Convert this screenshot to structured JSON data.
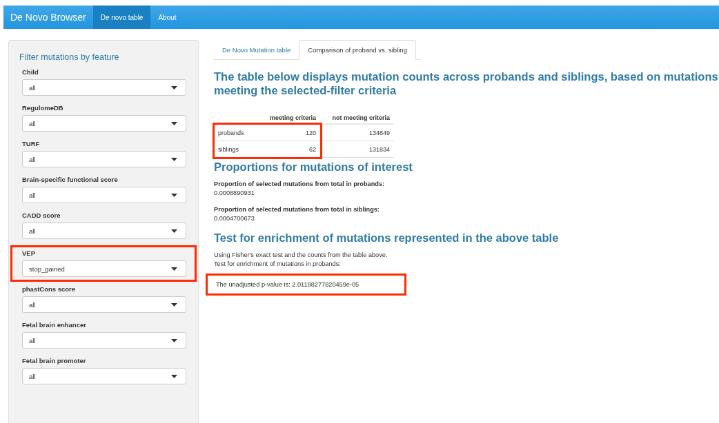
{
  "navbar": {
    "brand": "De Novo Browser",
    "items": [
      {
        "label": "De novo table",
        "selected": true
      },
      {
        "label": "About",
        "selected": false
      }
    ]
  },
  "sidebar": {
    "title": "Filter mutations by feature",
    "filters": [
      {
        "label": "Child",
        "value": "all",
        "highlighted": false
      },
      {
        "label": "RegulomeDB",
        "value": "all",
        "highlighted": false
      },
      {
        "label": "TURF",
        "value": "all",
        "highlighted": false
      },
      {
        "label": "Brain-specific functional score",
        "value": "all",
        "highlighted": false
      },
      {
        "label": "CADD score",
        "value": "all",
        "highlighted": false
      },
      {
        "label": "VEP",
        "value": "stop_gained",
        "highlighted": true
      },
      {
        "label": "phastCons score",
        "value": "all",
        "highlighted": false
      },
      {
        "label": "Fetal brain enhancer",
        "value": "all",
        "highlighted": false
      },
      {
        "label": "Fetal brain promoter",
        "value": "all",
        "highlighted": false
      }
    ]
  },
  "tabs": [
    {
      "label": "De Novo Mutation table",
      "selected": false
    },
    {
      "label": "Comparison of proband vs. sibling",
      "selected": true
    }
  ],
  "heading": "The table below displays mutation counts across probands and siblings, based on mutations meeting the selected-filter criteria",
  "table": {
    "columns": [
      "meeting criteria",
      "not meeting criteria"
    ],
    "highlighted": true,
    "rows": [
      {
        "name": "probands",
        "meeting": "120",
        "not_meeting": "134849"
      },
      {
        "name": "siblings",
        "meeting": "62",
        "not_meeting": "131834"
      }
    ]
  },
  "proportions": {
    "title": "Proportions for mutations of interest",
    "items": [
      {
        "label": "Proportion of selected mutations from total in probands:",
        "value": "0.0008890931"
      },
      {
        "label": "Proportion of selected mutations from total in siblings:",
        "value": "0.0004700673"
      }
    ]
  },
  "enrichment": {
    "title": "Test for enrichment of mutations represented in the above table",
    "lines": [
      "Using Fisher's exact test and the counts from the table above.",
      "Test for enrichment of mutations in probands:"
    ],
    "result": "The unadjusted p-value is: 2.01198277820459e-05",
    "highlighted": true
  }
}
